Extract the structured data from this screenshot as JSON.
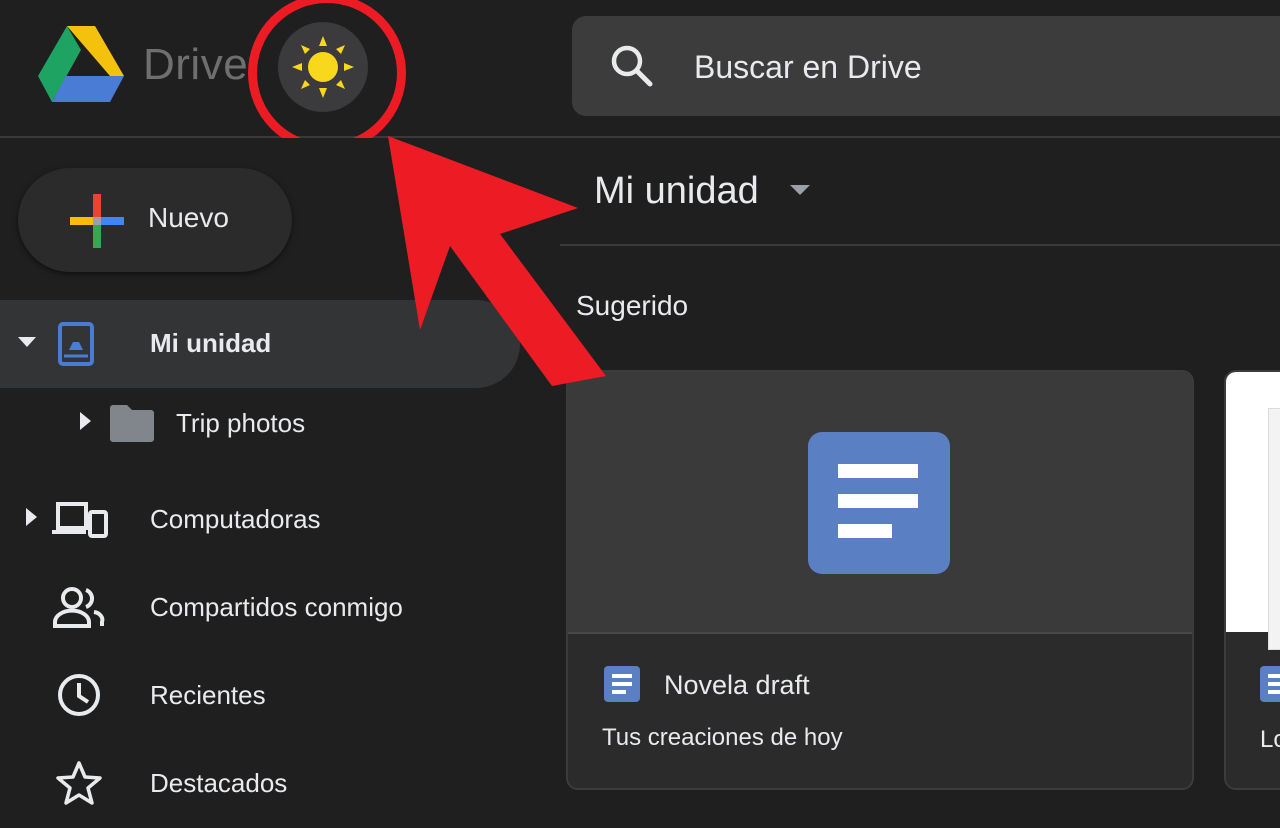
{
  "header": {
    "brand": "Drive",
    "search_placeholder": "Buscar en Drive"
  },
  "sidebar": {
    "new_label": "Nuevo",
    "items": [
      {
        "label": "Mi unidad"
      },
      {
        "label": "Trip photos"
      },
      {
        "label": "Computadoras"
      },
      {
        "label": "Compartidos conmigo"
      },
      {
        "label": "Recientes"
      },
      {
        "label": "Destacados"
      }
    ]
  },
  "main": {
    "title": "Mi unidad",
    "section": "Sugerido",
    "cards": [
      {
        "name": "Novela draft",
        "subtitle": "Tus creaciones de hoy"
      },
      {
        "subtitle": "Lo"
      }
    ]
  },
  "colors": {
    "accent_red": "#ed1c24",
    "docs_blue": "#5b7fc3",
    "sun_yellow": "#f9d71c"
  },
  "icons": [
    "drive-logo-icon",
    "sun-icon",
    "search-icon",
    "plus-icon",
    "drive-folder-icon",
    "folder-icon",
    "computers-icon",
    "shared-icon",
    "recent-icon",
    "star-icon",
    "docs-icon"
  ]
}
